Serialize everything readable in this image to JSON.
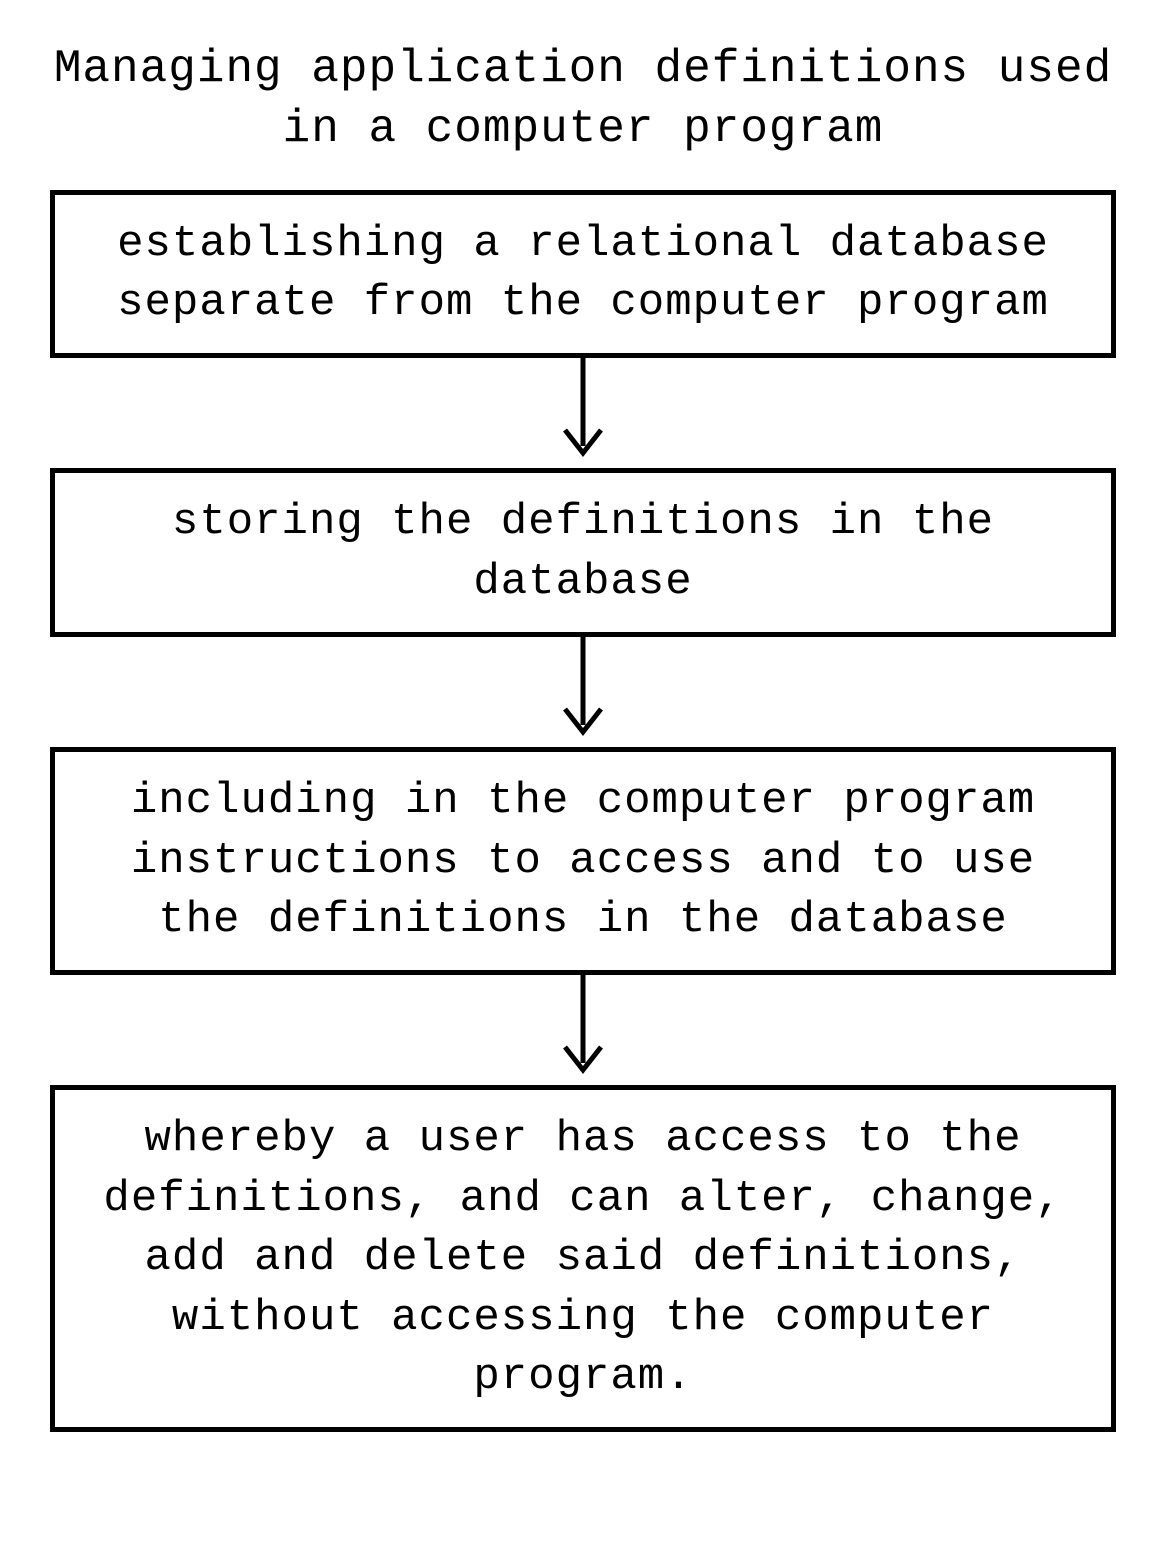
{
  "title": "Managing application definitions used in a computer program",
  "boxes": [
    "establishing a relational database separate from the computer program",
    "storing the definitions in the database",
    "including in the computer program instructions to access and to use the definitions in the database",
    "whereby a user has access to the definitions, and can alter, change, add and delete said definitions, without accessing the computer program."
  ]
}
